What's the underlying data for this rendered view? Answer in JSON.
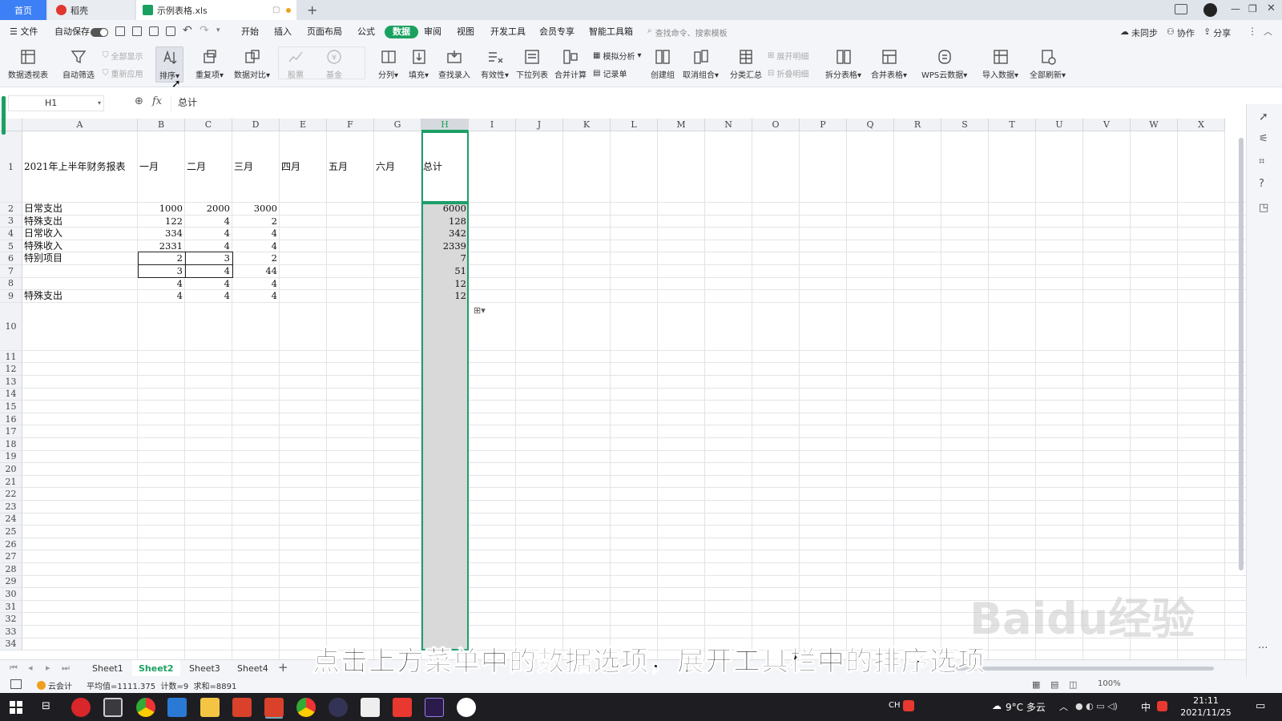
{
  "tabs": {
    "home": "首页",
    "daoke": "稻壳",
    "file": "示例表格.xls"
  },
  "menu": {
    "file": "文件",
    "autosave": "自动保存",
    "items": [
      "开始",
      "插入",
      "页面布局",
      "公式",
      "数据",
      "审阅",
      "视图",
      "开发工具",
      "会员专享",
      "智能工具箱"
    ],
    "active": "数据",
    "search_placeholder": "查找命令、搜索模板",
    "sync": "未同步",
    "collab": "协作",
    "share": "分享"
  },
  "ribbon": {
    "pivot": "数据透视表",
    "autofilter": "自动筛选",
    "show_all": "全部显示",
    "reapply": "重新应用",
    "sort": "排序",
    "duplicates": "重复项",
    "compare": "数据对比",
    "stock": "股票",
    "fund": "基金",
    "split": "分列",
    "fill": "填充",
    "lookup": "查找录入",
    "validity": "有效性",
    "dropdown": "下拉列表",
    "consolidate": "合并计算",
    "simulate": "模拟分析",
    "record": "记录单",
    "group": "创建组",
    "ungroup": "取消组合",
    "subtotal": "分类汇总",
    "expand": "展开明细",
    "collapse": "折叠明细",
    "split_table": "拆分表格",
    "merge_table": "合并表格",
    "wps_cloud": "WPS云数据",
    "import": "导入数据",
    "refresh_all": "全部刷新"
  },
  "formula": {
    "name_box": "H1",
    "fx": "fx",
    "content": "总计"
  },
  "columns": [
    "A",
    "B",
    "C",
    "D",
    "E",
    "F",
    "G",
    "H",
    "I",
    "J",
    "K",
    "L",
    "M",
    "N",
    "O",
    "P",
    "Q",
    "R",
    "S",
    "T",
    "U",
    "V",
    "W",
    "X"
  ],
  "rows": [
    "1",
    "2",
    "3",
    "4",
    "5",
    "6",
    "7",
    "8",
    "9",
    "10",
    "11",
    "12",
    "13",
    "14",
    "15",
    "16",
    "17",
    "18",
    "19",
    "20",
    "21",
    "22",
    "23",
    "24",
    "25",
    "26",
    "27",
    "28",
    "29",
    "30",
    "31",
    "32",
    "33",
    "34"
  ],
  "cells": {
    "A1": "2021年上半年财务报表",
    "B1": "一月",
    "C1": "二月",
    "D1": "三月",
    "E1": "四月",
    "F1": "五月",
    "G1": "六月",
    "H1": "总计",
    "A2": "日常支出",
    "B2": "1000",
    "C2": "2000",
    "D2": "3000",
    "H2": "6000",
    "A3": "特殊支出",
    "B3": "122",
    "C3": "4",
    "D3": "2",
    "H3": "128",
    "A4": "日常收入",
    "B4": "334",
    "C4": "4",
    "D4": "4",
    "H4": "342",
    "A5": "特殊收入",
    "B5": "2331",
    "C5": "4",
    "D5": "4",
    "H5": "2339",
    "A6": "特别项目",
    "B6": "2",
    "C6": "3",
    "D6": "2",
    "H6": "7",
    "B7": "3",
    "C7": "4",
    "D7": "44",
    "H7": "51",
    "B8": "4",
    "C8": "4",
    "D8": "4",
    "H8": "12",
    "A9": "特殊支出",
    "B9": "4",
    "C9": "4",
    "D9": "4",
    "H9": "12"
  },
  "sheets": [
    "Sheet1",
    "Sheet2",
    "Sheet3",
    "Sheet4"
  ],
  "active_sheet": "Sheet2",
  "status": {
    "cloud": "云会计",
    "stats": "平均值=1111.375  计数=9  求和=8891",
    "zoom": "100%"
  },
  "caption": "点击上方菜单中的数据选项，展开工具栏中的排序选项",
  "watermark": "Baidu经验",
  "taskbar": {
    "ime": "CH",
    "weather": "9°C 多云",
    "lang": "中",
    "time": "21:11",
    "date": "2021/11/25"
  },
  "colors": {
    "accent_green": "#1aa160",
    "selection_green": "#1e9e6a",
    "active_tab": "#2e6ae6"
  }
}
